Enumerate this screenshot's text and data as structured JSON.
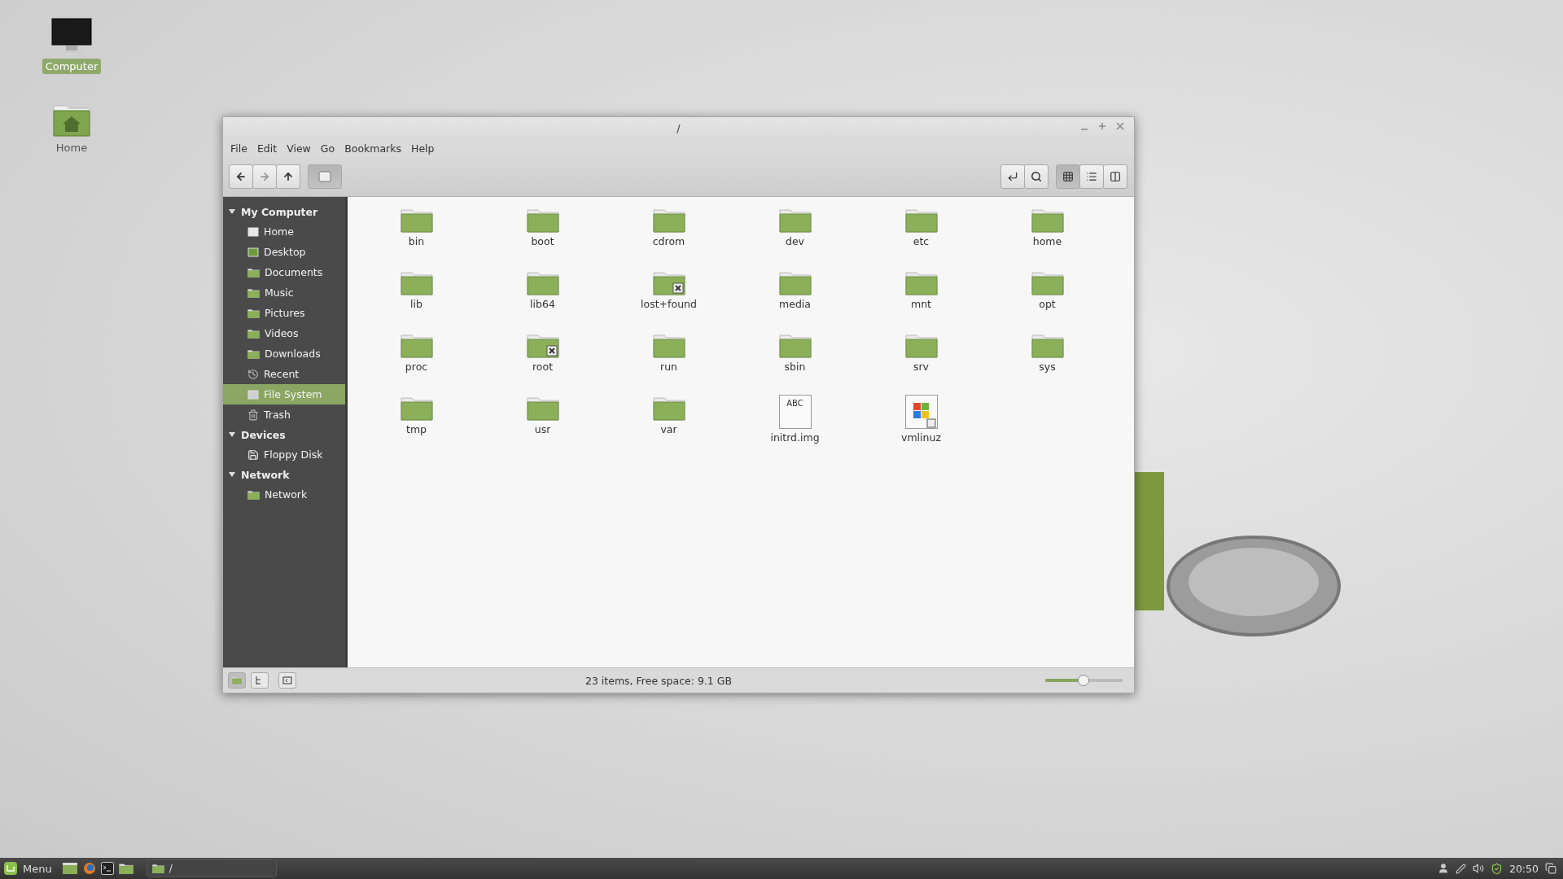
{
  "desktop_icons": [
    {
      "label": "Computer",
      "kind": "computer",
      "selected": true
    },
    {
      "label": "Home",
      "kind": "home",
      "selected": false
    }
  ],
  "window": {
    "title": "/",
    "menu": [
      "File",
      "Edit",
      "View",
      "Go",
      "Bookmarks",
      "Help"
    ],
    "nav_buttons": [
      {
        "kind": "back",
        "disabled": false
      },
      {
        "kind": "forward",
        "disabled": true
      },
      {
        "kind": "up",
        "disabled": false
      }
    ],
    "location_toggle": {
      "pressed": true
    },
    "view_buttons": [
      {
        "kind": "icons",
        "selected": true
      },
      {
        "kind": "list",
        "selected": false
      },
      {
        "kind": "compact",
        "selected": false
      }
    ],
    "sidebar": [
      {
        "label": "My Computer",
        "expanded": true,
        "items": [
          {
            "label": "Home",
            "kind": "home",
            "selected": false
          },
          {
            "label": "Desktop",
            "kind": "desktop",
            "selected": false
          },
          {
            "label": "Documents",
            "kind": "documents",
            "selected": false
          },
          {
            "label": "Music",
            "kind": "music",
            "selected": false
          },
          {
            "label": "Pictures",
            "kind": "pictures",
            "selected": false
          },
          {
            "label": "Videos",
            "kind": "videos",
            "selected": false
          },
          {
            "label": "Downloads",
            "kind": "downloads",
            "selected": false
          },
          {
            "label": "Recent",
            "kind": "recent",
            "selected": false
          },
          {
            "label": "File System",
            "kind": "drive",
            "selected": true
          },
          {
            "label": "Trash",
            "kind": "trash",
            "selected": false
          }
        ]
      },
      {
        "label": "Devices",
        "expanded": true,
        "items": [
          {
            "label": "Floppy Disk",
            "kind": "floppy",
            "selected": false
          }
        ]
      },
      {
        "label": "Network",
        "expanded": true,
        "items": [
          {
            "label": "Network",
            "kind": "network",
            "selected": false
          }
        ]
      }
    ],
    "files": [
      {
        "name": "bin",
        "kind": "folder"
      },
      {
        "name": "boot",
        "kind": "folder"
      },
      {
        "name": "cdrom",
        "kind": "folder"
      },
      {
        "name": "dev",
        "kind": "folder"
      },
      {
        "name": "etc",
        "kind": "folder"
      },
      {
        "name": "home",
        "kind": "folder"
      },
      {
        "name": "lib",
        "kind": "folder"
      },
      {
        "name": "lib64",
        "kind": "folder"
      },
      {
        "name": "lost+found",
        "kind": "locked"
      },
      {
        "name": "media",
        "kind": "folder"
      },
      {
        "name": "mnt",
        "kind": "folder"
      },
      {
        "name": "opt",
        "kind": "folder"
      },
      {
        "name": "proc",
        "kind": "folder"
      },
      {
        "name": "root",
        "kind": "locked"
      },
      {
        "name": "run",
        "kind": "folder"
      },
      {
        "name": "sbin",
        "kind": "folder"
      },
      {
        "name": "srv",
        "kind": "folder"
      },
      {
        "name": "sys",
        "kind": "folder"
      },
      {
        "name": "tmp",
        "kind": "folder"
      },
      {
        "name": "usr",
        "kind": "folder"
      },
      {
        "name": "var",
        "kind": "folder"
      },
      {
        "name": "initrd.img",
        "kind": "text",
        "badge": "ABC"
      },
      {
        "name": "vmlinuz",
        "kind": "binary"
      }
    ],
    "status": "23 items, Free space: 9.1 GB",
    "zoom": {
      "level": 0.49
    }
  },
  "taskbar": {
    "menu_label": "Menu",
    "windows": [
      {
        "label": "/",
        "selected": false
      }
    ],
    "clock": "20:50"
  }
}
